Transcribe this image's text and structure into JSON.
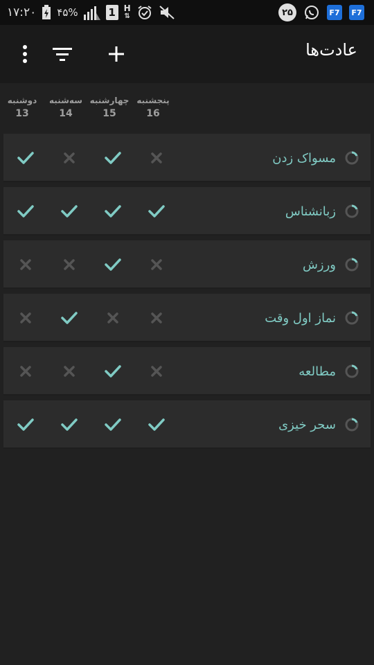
{
  "status_bar": {
    "time": "۱۷:۲۰",
    "battery": "۴۵%",
    "sim": "1",
    "network": "H",
    "notification_count": "۲۵",
    "icons": [
      "battery-charging-icon",
      "signal-icon",
      "sim-icon",
      "network-h-icon",
      "alarm-icon",
      "mute-icon",
      "notification-badge",
      "whatsapp-icon",
      "app-icon",
      "app-icon"
    ]
  },
  "app_bar": {
    "title": "عادت‌ها",
    "icons": [
      "overflow-menu-icon",
      "filter-icon",
      "add-icon"
    ]
  },
  "days": [
    {
      "name": "پنجشنبه",
      "num": "16"
    },
    {
      "name": "چهارشنبه",
      "num": "15"
    },
    {
      "name": "سه‌شنبه",
      "num": "14"
    },
    {
      "name": "دوشنبه",
      "num": "13"
    }
  ],
  "habits": [
    {
      "name": "مسواک زدن",
      "checks": [
        false,
        true,
        false,
        true
      ]
    },
    {
      "name": "زبانشناس",
      "checks": [
        true,
        true,
        true,
        true
      ]
    },
    {
      "name": "ورزش",
      "checks": [
        false,
        true,
        false,
        false
      ]
    },
    {
      "name": "نماز اول وقت",
      "checks": [
        false,
        false,
        true,
        false
      ]
    },
    {
      "name": "مطالعه",
      "checks": [
        false,
        true,
        false,
        false
      ]
    },
    {
      "name": "سحر خیزی",
      "checks": [
        true,
        true,
        true,
        true
      ]
    }
  ],
  "colors": {
    "accent": "#80cbc4",
    "check": "#80cbc4",
    "cross": "#555555",
    "row_bg": "#2c2c2c",
    "bg": "#212121"
  }
}
